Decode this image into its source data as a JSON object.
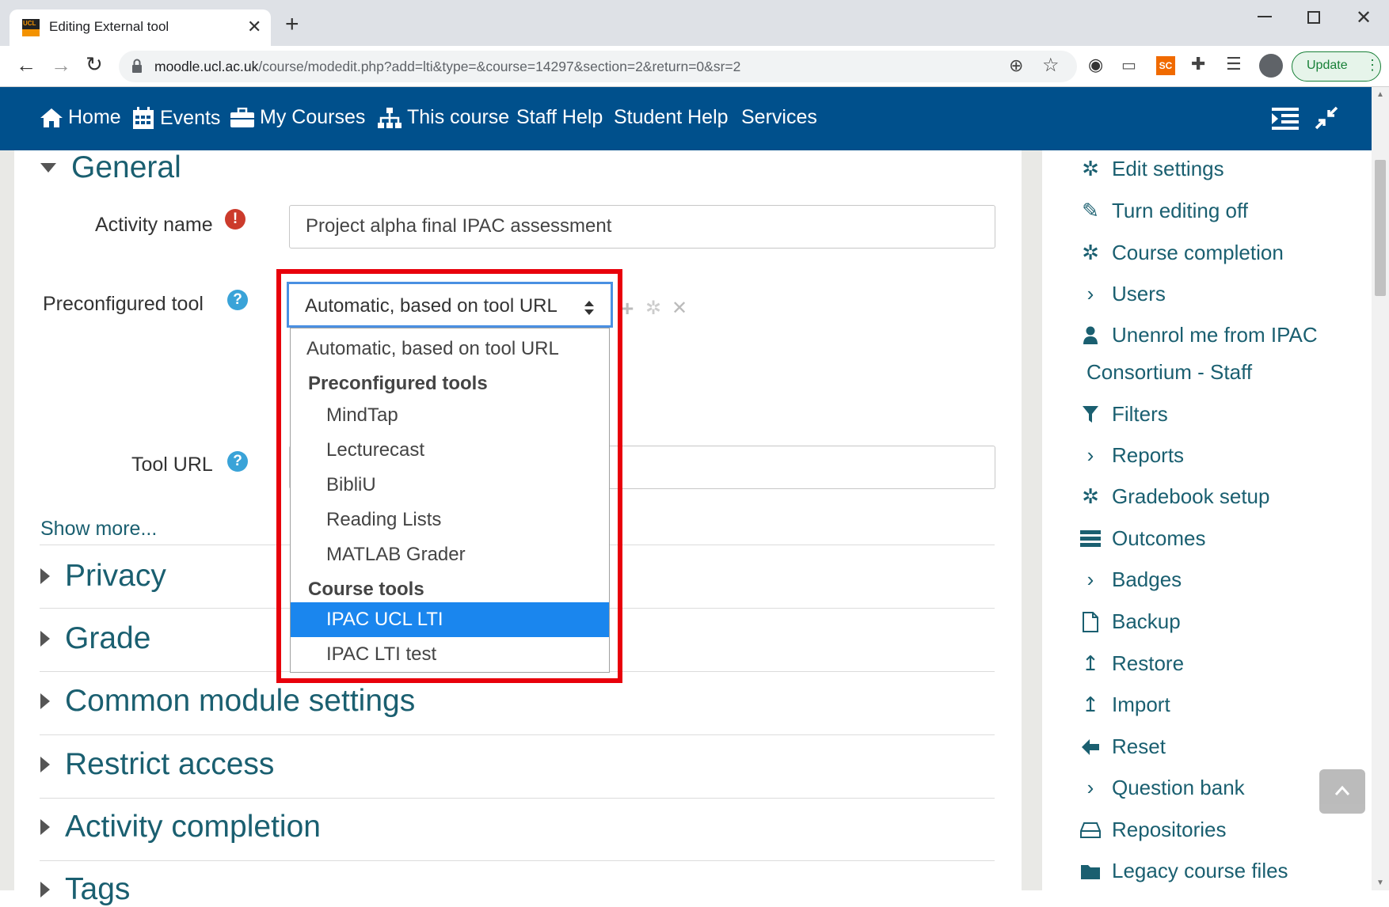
{
  "browser": {
    "tab_title": "Editing External tool",
    "url_host": "moodle.ucl.ac.uk",
    "url_path": "/course/modedit.php?add=lti&type=&course=14297&section=2&return=0&sr=2",
    "update_label": "Update",
    "favicon_text": "UCL"
  },
  "navbar": {
    "items": [
      "Home",
      "Events",
      "My Courses",
      "This course",
      "Staff Help",
      "Student Help",
      "Services"
    ]
  },
  "form": {
    "general_title": "General",
    "activity_name_label": "Activity name",
    "activity_name_value": "Project alpha final IPAC assessment",
    "preconfigured_label": "Preconfigured tool",
    "tool_url_label": "Tool URL",
    "show_more": "Show more...",
    "sections": [
      "Privacy",
      "Grade",
      "Common module settings",
      "Restrict access",
      "Activity completion",
      "Tags"
    ]
  },
  "dropdown": {
    "value": "Automatic, based on tool URL",
    "first_option": "Automatic, based on tool URL",
    "group1": "Preconfigured tools",
    "group1_options": [
      "MindTap",
      "Lecturecast",
      "BibliU",
      "Reading Lists",
      "MATLAB Grader"
    ],
    "group2": "Course tools",
    "group2_options": [
      "IPAC UCL LTI",
      "IPAC LTI test"
    ],
    "selected": "IPAC UCL LTI"
  },
  "sidebar": {
    "items": [
      {
        "label": "Edit settings",
        "icon": "gear-icon"
      },
      {
        "label": "Turn editing off",
        "icon": "pencil-icon"
      },
      {
        "label": "Course completion",
        "icon": "gear-icon"
      },
      {
        "label": "Users",
        "icon": "chevron-right-icon"
      },
      {
        "label": "Unenrol me from IPAC",
        "icon": "user-icon"
      },
      {
        "label": "Consortium - Staff",
        "icon": ""
      },
      {
        "label": "Filters",
        "icon": "filter-icon"
      },
      {
        "label": "Reports",
        "icon": "chevron-right-icon"
      },
      {
        "label": "Gradebook setup",
        "icon": "gear-icon"
      },
      {
        "label": "Outcomes",
        "icon": "list-icon"
      },
      {
        "label": "Badges",
        "icon": "chevron-right-icon"
      },
      {
        "label": "Backup",
        "icon": "file-icon"
      },
      {
        "label": "Restore",
        "icon": "upload-arrow-icon"
      },
      {
        "label": "Import",
        "icon": "upload-arrow-icon"
      },
      {
        "label": "Reset",
        "icon": "arrow-left-icon"
      },
      {
        "label": "Question bank",
        "icon": "chevron-right-icon"
      },
      {
        "label": "Repositories",
        "icon": "drive-icon"
      },
      {
        "label": "Legacy course files",
        "icon": "folder-icon"
      }
    ]
  },
  "colors": {
    "navbar": "#00508c",
    "link_teal": "#1a5f70",
    "selected_option": "#1a86ee",
    "highlight_box": "#e8000b"
  }
}
